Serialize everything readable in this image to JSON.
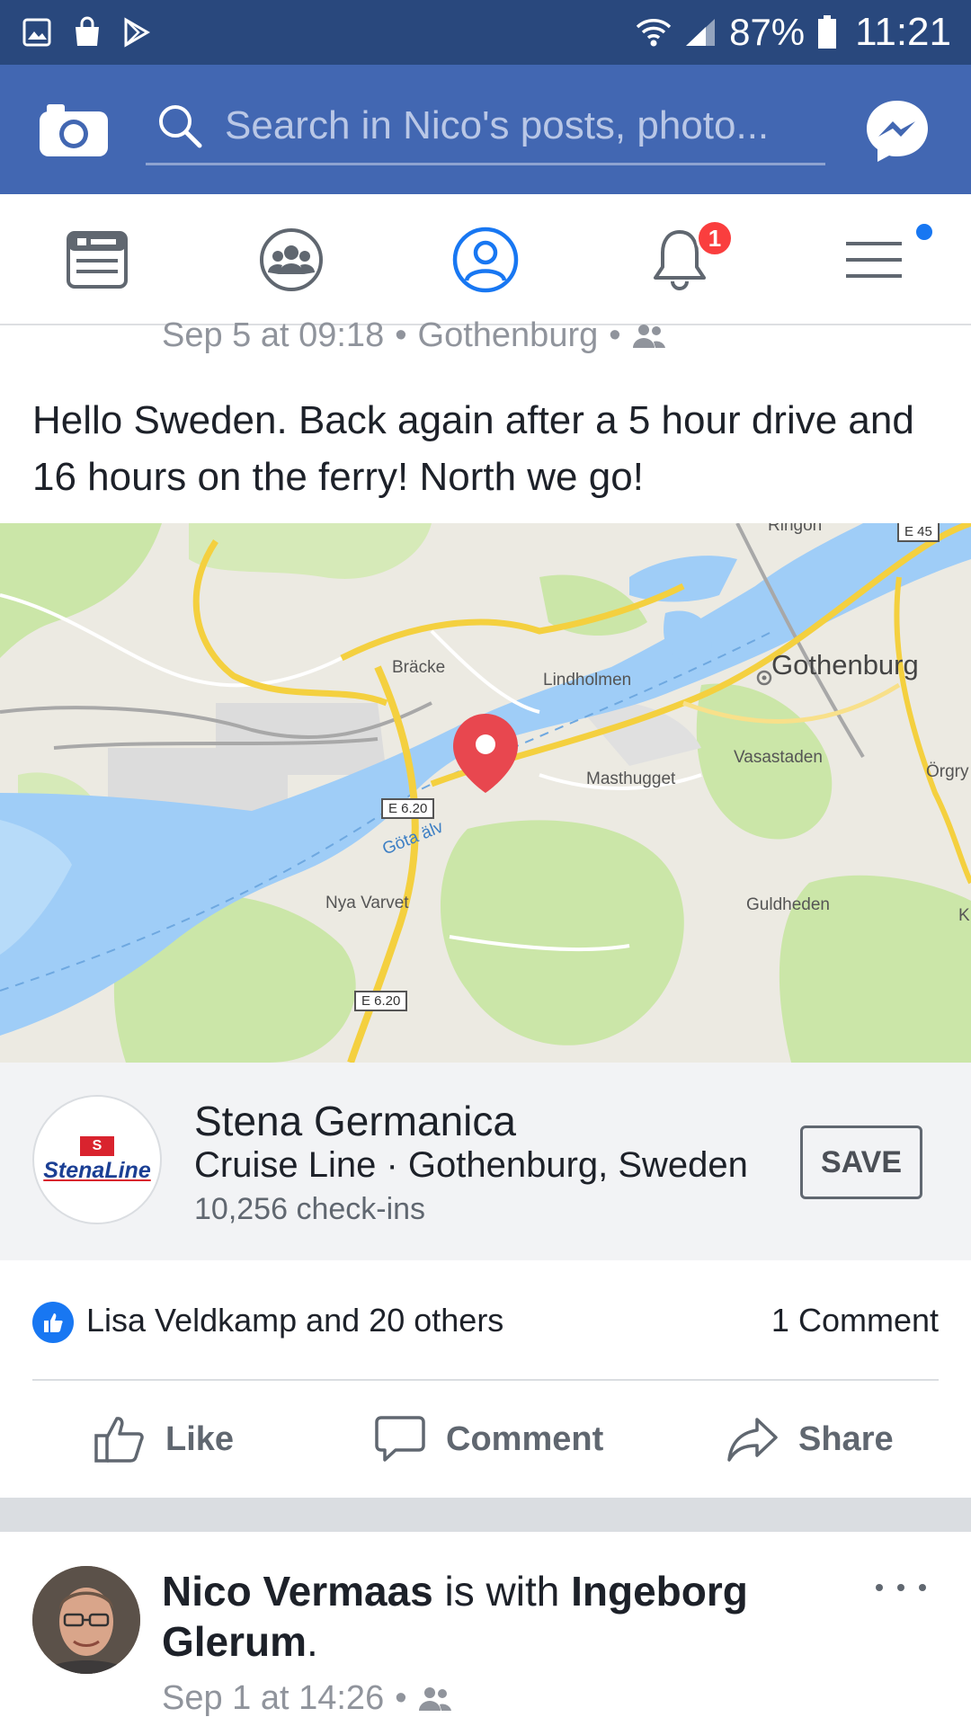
{
  "status_bar": {
    "battery": "87%",
    "time": "11:21"
  },
  "app_bar": {
    "search_placeholder": "Search in Nico's posts, photo..."
  },
  "tabs": [
    {
      "name": "news-feed",
      "icon": "news-feed-icon"
    },
    {
      "name": "groups",
      "icon": "groups-icon"
    },
    {
      "name": "profile",
      "icon": "profile-icon"
    },
    {
      "name": "notifications",
      "icon": "bell-icon",
      "badge": "1"
    },
    {
      "name": "menu",
      "icon": "menu-icon"
    }
  ],
  "post1": {
    "date": "Sep 5 at 09:18",
    "location": "Gothenburg",
    "privacy_icon": "friends-icon",
    "text": "Hello Sweden. Back again after a 5 hour drive and 16 hours on the ferry! North we go!",
    "map": {
      "labels": {
        "gothenburg": "Gothenburg",
        "bracke": "Bräcke",
        "lindholmen": "Lindholmen",
        "vasastaden": "Vasastaden",
        "masthugget": "Masthugget",
        "orgryte": "Örgry",
        "gota_alv": "Göta älv",
        "nya_varvet": "Nya Varvet",
        "guldheden": "Guldheden",
        "ringon": "Ringön",
        "k": "K"
      },
      "shields": {
        "e45": "E 45",
        "e620_a": "E 6.20",
        "e620_b": "E 6.20"
      }
    },
    "place": {
      "logo_flag": "S",
      "logo_text": "StenaLine",
      "name": "Stena Germanica",
      "category": "Cruise Line · Gothenburg, Sweden",
      "checkins": "10,256 check-ins",
      "save_label": "SAVE"
    },
    "reactions_text": "Lisa Veldkamp and 20 others",
    "comments_text": "1 Comment",
    "actions": {
      "like": "Like",
      "comment": "Comment",
      "share": "Share"
    }
  },
  "post2": {
    "author": "Nico Vermaas",
    "with_text": " is with ",
    "tagged": "Ingeborg Glerum",
    "period": ".",
    "date": "Sep 1 at 14:26"
  },
  "colors": {
    "status_bar": "#29487d",
    "app_bar": "#4267b2",
    "accent": "#1877f2",
    "badge": "#fa3e3e",
    "pin": "#e8474f",
    "water": "#9fcdf7",
    "park": "#cbe6a8"
  }
}
